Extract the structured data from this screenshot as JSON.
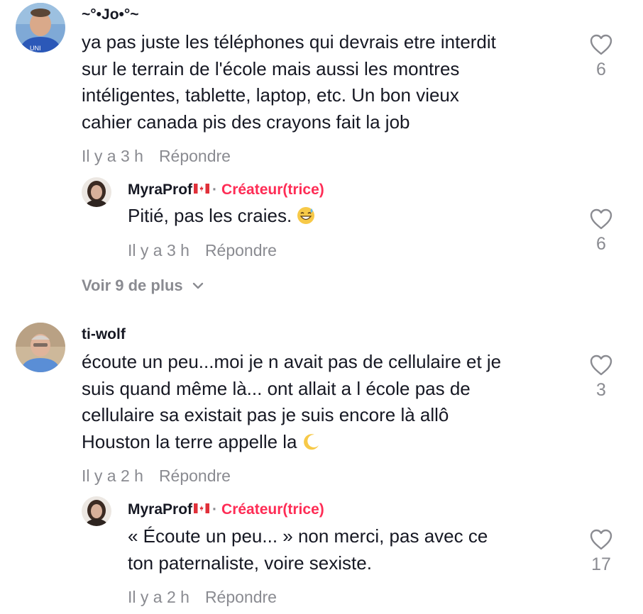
{
  "comments": [
    {
      "username": "~°•Jo•°~",
      "text_lines": [
        "ya pas juste les téléphones qui devrais etre interdit",
        "sur le terrain de l'école mais aussi les montres",
        "intéligentes, tablette, laptop, etc. Un bon vieux",
        "cahier canada pis des crayons fait la job"
      ],
      "time": "Il y a 3 h",
      "reply_label": "Répondre",
      "likes": "6",
      "reply": {
        "username": "MyraProf",
        "creator_label": "Créateur(trice)",
        "separator": "·",
        "text": "Pitié, pas les craies.",
        "emoji": "grinning-sweat-emoji",
        "time": "Il y a 3 h",
        "reply_label": "Répondre",
        "likes": "6"
      },
      "view_more": "Voir 9 de plus"
    },
    {
      "username": "ti-wolf",
      "text_lines": [
        "écoute un peu...moi je n avait pas de cellulaire et je",
        "suis quand même là... ont allait a l école pas de",
        "cellulaire sa existait pas je suis encore là allô",
        "Houston la terre appelle la"
      ],
      "emoji": "crescent-moon-emoji",
      "time": "Il y a 2 h",
      "reply_label": "Répondre",
      "likes": "3",
      "reply": {
        "username": "MyraProf",
        "creator_label": "Créateur(trice)",
        "separator": "·",
        "text_lines": [
          "« Écoute un peu... » non merci, pas avec ce",
          "ton paternaliste, voire sexiste."
        ],
        "time": "Il y a 2 h",
        "reply_label": "Répondre",
        "likes": "17"
      }
    }
  ],
  "colors": {
    "text": "#161823",
    "muted": "#8a8b91",
    "creator": "#fe2c55"
  },
  "icons": {
    "like": "heart-outline-icon",
    "expand": "chevron-down-icon",
    "flag": "canada-flag-icon"
  }
}
